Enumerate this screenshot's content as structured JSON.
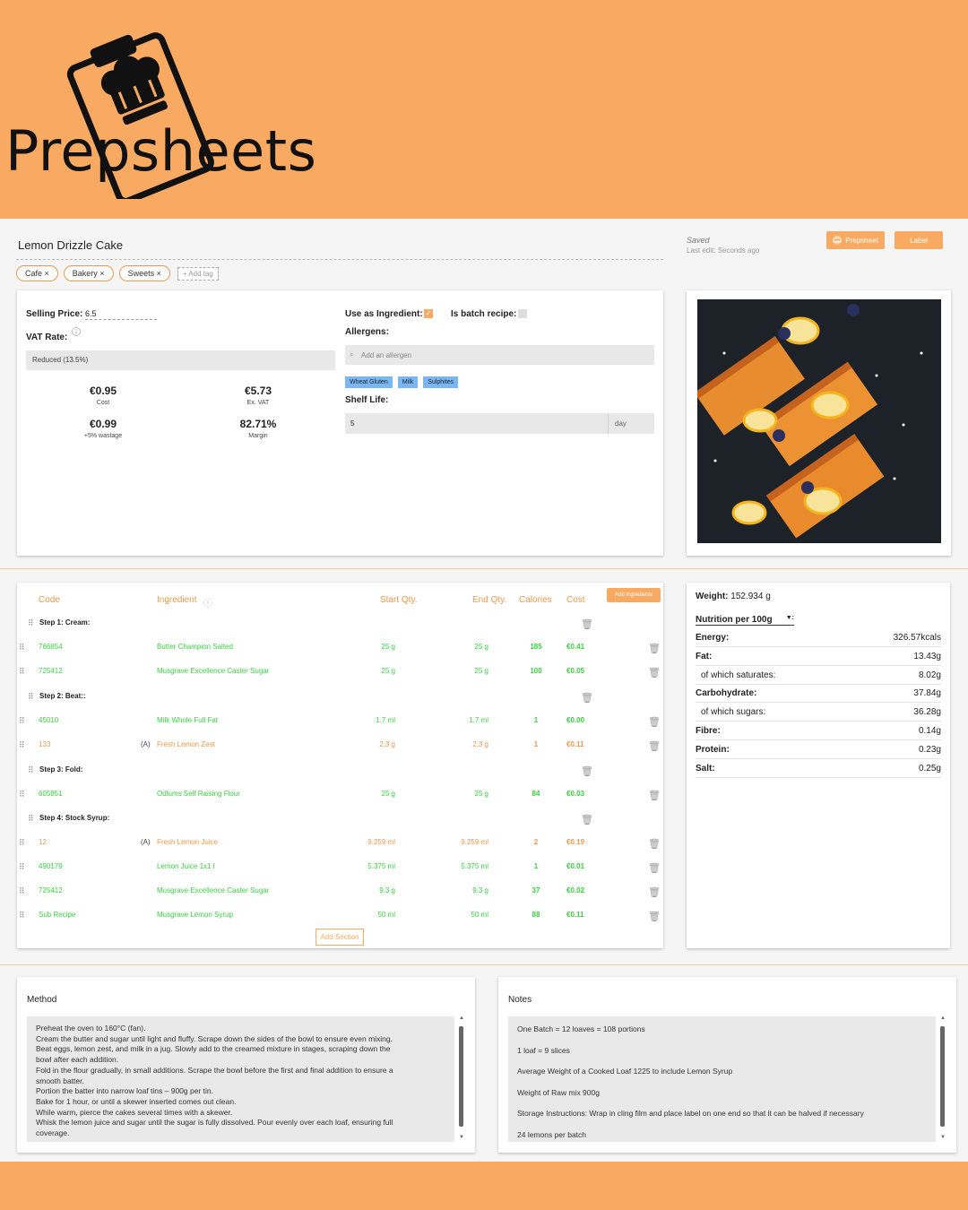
{
  "brand": {
    "name": "Prepsheets",
    "accent": "#f9aa62"
  },
  "recipe": {
    "title": "Lemon Drizzle Cake",
    "tags": [
      "Cafe ×",
      "Bakery ×",
      "Sweets ×"
    ],
    "add_tag": "+ Add tag"
  },
  "status": {
    "saved": "Saved",
    "last_edit": "Last edit: Seconds ago"
  },
  "buttons": {
    "prepsheet": "Prepsheet",
    "label": "Label",
    "add_ingredients": "Add Ingredients",
    "add_section": "Add Section"
  },
  "pricing": {
    "selling_price_label": "Selling Price:",
    "selling_price_value": "6.5",
    "vat_rate_label": "VAT Rate:",
    "vat_rate_value": "Reduced (13.5%)",
    "cost_value": "€0.95",
    "cost_label": "Cost",
    "exvat_value": "€5.73",
    "exvat_label": "Ex. VAT",
    "wastage_value": "€0.99",
    "wastage_label": "+5% wastage",
    "margin_value": "82.71%",
    "margin_label": "Margin"
  },
  "settings": {
    "use_as_ingredient_label": "Use as Ingredient:",
    "use_as_ingredient_checked": true,
    "batch_label": "Is batch recipe:",
    "batch_checked": false,
    "allergens_label": "Allergens:",
    "allergen_placeholder": "Add an allergen",
    "allergens": [
      "Wheat Gluten",
      "Milk",
      "Sulphites"
    ],
    "shelf_life_label": "Shelf Life:",
    "shelf_life_value": "5",
    "shelf_life_unit": "day"
  },
  "ingredients": {
    "headers": {
      "code": "Code",
      "ingredient": "Ingredient",
      "start_qty": "Start Qty.",
      "end_qty": "End Qty.",
      "calories": "Calories",
      "cost": "Cost"
    },
    "steps": [
      {
        "label": "Step 1: Cream:",
        "rows": [
          {
            "code": "766854",
            "tag": "",
            "name": "Butter Champion Salted",
            "start": "25 g",
            "end": "25 g",
            "cal": "185",
            "cost": "€0.41",
            "color": "green"
          },
          {
            "code": "725412",
            "tag": "",
            "name": "Musgrave Excellence Caster Sugar",
            "start": "25 g",
            "end": "25 g",
            "cal": "100",
            "cost": "€0.05",
            "color": "green"
          }
        ]
      },
      {
        "label": "Step 2: Beat::",
        "rows": [
          {
            "code": "45010",
            "tag": "",
            "name": "Milk Whole Full Fat",
            "start": "1.7 ml",
            "end": "1.7 ml",
            "cal": "1",
            "cost": "€0.00",
            "color": "green"
          },
          {
            "code": "133",
            "tag": "(A)",
            "name": "Fresh Lemon Zest",
            "start": "2.3 g",
            "end": "2.3 g",
            "cal": "1",
            "cost": "€0.11",
            "color": "orange"
          }
        ]
      },
      {
        "label": "Step 3: Fold:",
        "rows": [
          {
            "code": "605851",
            "tag": "",
            "name": "Odlums Self Raising Flour",
            "start": "25 g",
            "end": "25 g",
            "cal": "84",
            "cost": "€0.03",
            "color": "green"
          }
        ]
      },
      {
        "label": "Step 4: Stock Syrup:",
        "rows": [
          {
            "code": "12",
            "tag": "(A)",
            "name": "Fresh Lemon Juice",
            "start": "9.259 ml",
            "end": "9.259 ml",
            "cal": "2",
            "cost": "€0.19",
            "color": "orange"
          },
          {
            "code": "490179",
            "tag": "",
            "name": "Lemon Juice 1x1 l",
            "start": "5.375 ml",
            "end": "5.375 ml",
            "cal": "1",
            "cost": "€0.01",
            "color": "green"
          },
          {
            "code": "725412",
            "tag": "",
            "name": "Musgrave Excellence Caster Sugar",
            "start": "9.3 g",
            "end": "9.3 g",
            "cal": "37",
            "cost": "€0.02",
            "color": "green"
          },
          {
            "code": "Sub Recipe",
            "tag": "",
            "name": "Musgrave Lemon Syrup",
            "start": "50 ml",
            "end": "50 ml",
            "cal": "88",
            "cost": "€0.11",
            "color": "green"
          }
        ]
      }
    ]
  },
  "nutrition": {
    "weight_label": "Weight:",
    "weight_value": "152.934 g",
    "per_label": "Nutrition per 100g",
    "rows": [
      {
        "k": "Energy:",
        "v": "326.57kcals",
        "bold": true
      },
      {
        "k": "Fat:",
        "v": "13.43g",
        "bold": true
      },
      {
        "k": "of which saturates:",
        "v": "8.02g",
        "bold": false
      },
      {
        "k": "Carbohydrate:",
        "v": "37.84g",
        "bold": true
      },
      {
        "k": "of which sugars:",
        "v": "36.28g",
        "bold": false
      },
      {
        "k": "Fibre:",
        "v": "0.14g",
        "bold": true
      },
      {
        "k": "Protein:",
        "v": "0.23g",
        "bold": true
      },
      {
        "k": "Salt:",
        "v": "0.25g",
        "bold": true
      }
    ]
  },
  "method": {
    "title": "Method",
    "lines": [
      "Preheat the oven to 160°C (fan).",
      "Cream the butter and sugar until light and fluffy. Scrape down the sides of the bowl to ensure even mixing.",
      "Beat eggs, lemon zest, and milk in a jug. Slowly add to the creamed mixture in stages, scraping down the",
      "bowl after each addition.",
      "Fold in the flour gradually, in small additions. Scrape the bowl before the first and final addition to ensure a",
      "smooth batter.",
      "Portion the batter into narrow loaf tins – 900g per tin.",
      "Bake for 1 hour, or until a skewer inserted comes out clean.",
      "While warm, pierce the cakes several times with a skewer.",
      "Whisk the lemon juice and sugar until the sugar is fully dissolved. Pour evenly over each loaf, ensuring full",
      "coverage."
    ]
  },
  "notes": {
    "title": "Notes",
    "lines": [
      "One Batch = 12 loaves = 108 portions",
      "1 loaf = 9 slices",
      "Average Weight of a Cooked Loaf 1225 to include Lemon Syrup",
      "Weight of Raw mix 900g",
      "Storage Instructions: Wrap in cling film and place label on one end so that it can be halved if necessary",
      "24 lemons per batch"
    ]
  }
}
